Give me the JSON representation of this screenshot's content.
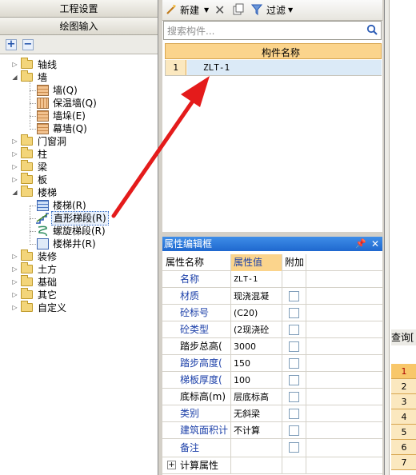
{
  "left_panel": {
    "tab_settings": "工程设置",
    "tab_drawing": "绘图输入",
    "add_btn": "+",
    "remove_btn": "−",
    "tree": [
      {
        "label": "轴线"
      },
      {
        "label": "墙",
        "children": [
          "墙(Q)",
          "保温墙(Q)",
          "墙垛(E)",
          "幕墙(Q)"
        ]
      },
      {
        "label": "门窗洞"
      },
      {
        "label": "柱"
      },
      {
        "label": "梁"
      },
      {
        "label": "板"
      },
      {
        "label": "楼梯",
        "children": [
          "楼梯(R)",
          "直形梯段(R)",
          "螺旋梯段(R)",
          "楼梯井(R)"
        ]
      },
      {
        "label": "装修"
      },
      {
        "label": "土方"
      },
      {
        "label": "基础"
      },
      {
        "label": "其它"
      },
      {
        "label": "自定义"
      }
    ]
  },
  "component_list": {
    "toolbar": {
      "new_label": "新建",
      "filter_label": "过滤"
    },
    "search_placeholder": "搜索构件...",
    "column_header": "构件名称",
    "rows": [
      {
        "num": "1",
        "name": "ZLT-1"
      }
    ]
  },
  "property_editor": {
    "title": "属性编辑框",
    "headers": {
      "name": "属性名称",
      "value": "属性值",
      "extra": "附加"
    },
    "rows": [
      {
        "name": "名称",
        "value": "ZLT-1"
      },
      {
        "name": "材质",
        "value": "现浇混凝"
      },
      {
        "name": "砼标号",
        "value": "(C20)"
      },
      {
        "name": "砼类型",
        "value": "(2现浇砼"
      },
      {
        "name": "踏步总高(",
        "value": "3000"
      },
      {
        "name": "踏步高度(",
        "value": "150"
      },
      {
        "name": "梯板厚度(",
        "value": "100"
      },
      {
        "name": "底标高(m)",
        "value": "层底标高"
      },
      {
        "name": "类别",
        "value": "无斜梁"
      },
      {
        "name": "建筑面积计",
        "value": "不计算"
      },
      {
        "name": "备注",
        "value": ""
      },
      {
        "name": "计算属性",
        "value": ""
      }
    ]
  },
  "right_panel": {
    "query_label": "查询[",
    "row_numbers": [
      "1",
      "2",
      "3",
      "4",
      "5",
      "6",
      "7"
    ]
  },
  "colors": {
    "header_orange": "#fbd48c",
    "selection_blue": "#dbeaf7",
    "title_blue": "#2a78dc",
    "arrow_red": "#e41b1b"
  }
}
